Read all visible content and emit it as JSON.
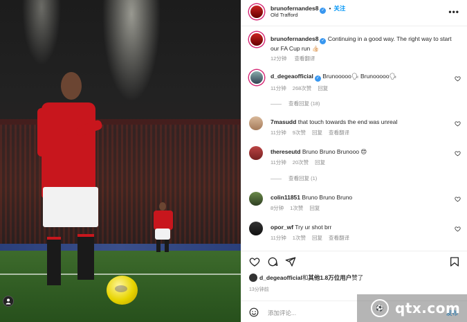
{
  "header": {
    "username": "brunofernandes8",
    "follow_label": "关注",
    "location": "Old Trafford",
    "more_label": "•••"
  },
  "caption": {
    "username": "brunofernandes8",
    "text": "Continuing in a good way. The right way to start our FA Cup run 👍🏻",
    "time": "12分钟",
    "translate": "查看翻译"
  },
  "comments": [
    {
      "username": "d_degeaofficial",
      "text": "Brunooooo🗣 Brunooooo🗣",
      "time": "11分钟",
      "likes": "268次赞",
      "reply": "回复",
      "view_replies": "查看回复 (18)"
    },
    {
      "username": "7masudd",
      "text": "that touch towards the end was unreal",
      "time": "11分钟",
      "likes": "9次赞",
      "reply": "回复",
      "translate": "查看翻译"
    },
    {
      "username": "thereseutd",
      "text": "Bruno Bruno Brunooo 😍",
      "time": "11分钟",
      "likes": "20次赞",
      "reply": "回复",
      "view_replies": "查看回复 (1)"
    },
    {
      "username": "colin11851",
      "text": "Bruno Bruno Bruno",
      "time": "8分钟",
      "likes": "1次赞",
      "reply": "回复"
    },
    {
      "username": "opor_wf",
      "text": "Try ur shot brr",
      "time": "11分钟",
      "likes": "1次赞",
      "reply": "回复",
      "translate": "查看翻译"
    }
  ],
  "likes_line": {
    "user": "d_degeaofficial",
    "middle": "和",
    "others": "其他1.8万位用户",
    "suffix": "赞了"
  },
  "post_time": "13分钟前",
  "add_comment": {
    "placeholder": "添加评论...",
    "post_label": "发布"
  },
  "watermark": {
    "text": "qtx.com"
  },
  "icons": {
    "heart": "heart-icon",
    "comment": "comment-icon",
    "share": "share-icon",
    "save": "bookmark-icon",
    "emoji": "emoji-icon",
    "user_tag": "user-tag-icon"
  },
  "colors": {
    "link_blue": "#0095f6",
    "verified": "#3897f0",
    "muted": "#8e8e8e",
    "united_red": "#c8161d"
  }
}
